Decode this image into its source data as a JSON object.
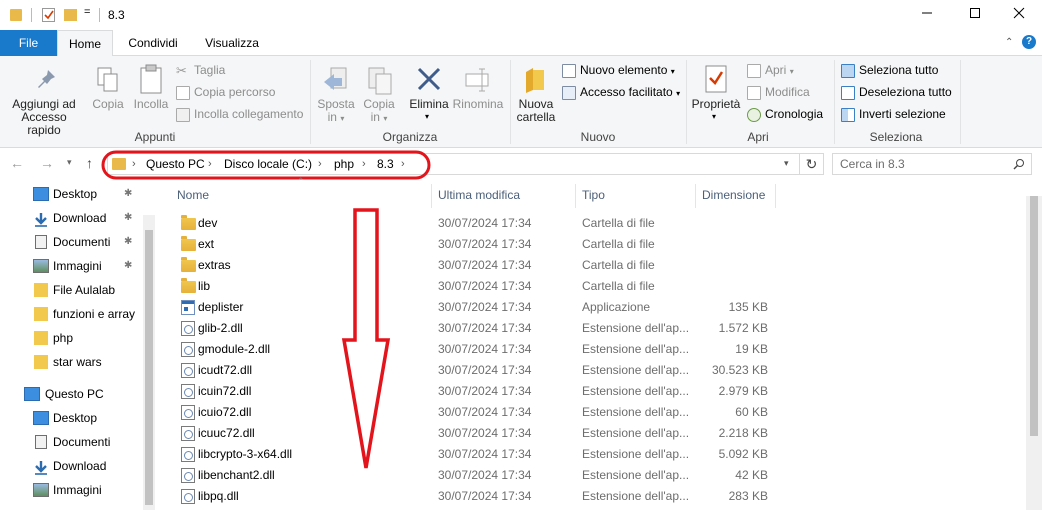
{
  "window": {
    "title": "8.3",
    "qa_dropdown": "="
  },
  "ribbon_tabs": [
    {
      "label": "File"
    },
    {
      "label": "Home"
    },
    {
      "label": "Condividi"
    },
    {
      "label": "Visualizza"
    }
  ],
  "ribbon": {
    "appunti": {
      "group_label": "Appunti",
      "pin_label_1": "Aggiungi ad",
      "pin_label_2": "Accesso rapido",
      "copy": "Copia",
      "paste": "Incolla",
      "cut": "Taglia",
      "copy_path": "Copia percorso",
      "paste_shortcut": "Incolla collegamento"
    },
    "organizza": {
      "group_label": "Organizza",
      "move_1": "Sposta",
      "move_2": "in",
      "copyto_1": "Copia",
      "copyto_2": "in",
      "delete": "Elimina",
      "rename": "Rinomina"
    },
    "nuovo": {
      "group_label": "Nuovo",
      "new_folder_1": "Nuova",
      "new_folder_2": "cartella",
      "new_item": "Nuovo elemento",
      "easy_access": "Accesso facilitato"
    },
    "apri": {
      "group_label": "Apri",
      "properties": "Proprietà",
      "open": "Apri",
      "edit": "Modifica",
      "history": "Cronologia"
    },
    "seleziona": {
      "group_label": "Seleziona",
      "select_all": "Seleziona tutto",
      "select_none": "Deseleziona tutto",
      "invert": "Inverti selezione"
    }
  },
  "address": {
    "crumbs": [
      "Questo PC",
      "Disco locale (C:)",
      "php",
      "8.3"
    ],
    "search_placeholder": "Cerca in 8.3"
  },
  "nav": {
    "quick_access": [
      {
        "label": "Desktop",
        "pinned": true
      },
      {
        "label": "Download",
        "pinned": true
      },
      {
        "label": "Documenti",
        "pinned": true
      },
      {
        "label": "Immagini",
        "pinned": true
      },
      {
        "label": "File Aulalab",
        "pinned": false
      },
      {
        "label": "funzioni e array",
        "pinned": false
      },
      {
        "label": "php",
        "pinned": false
      },
      {
        "label": "star wars",
        "pinned": false
      }
    ],
    "this_pc": "Questo PC",
    "this_pc_items": [
      {
        "label": "Desktop"
      },
      {
        "label": "Documenti"
      },
      {
        "label": "Download"
      },
      {
        "label": "Immagini"
      }
    ],
    "pin_glyph": "✱"
  },
  "columns": {
    "name": "Nome",
    "date": "Ultima modifica",
    "type": "Tipo",
    "size": "Dimensione"
  },
  "files": [
    {
      "name": "dev",
      "date": "30/07/2024 17:34",
      "type": "Cartella di file",
      "size": "",
      "icon": "folder-icon"
    },
    {
      "name": "ext",
      "date": "30/07/2024 17:34",
      "type": "Cartella di file",
      "size": "",
      "icon": "folder-icon"
    },
    {
      "name": "extras",
      "date": "30/07/2024 17:34",
      "type": "Cartella di file",
      "size": "",
      "icon": "folder-icon"
    },
    {
      "name": "lib",
      "date": "30/07/2024 17:34",
      "type": "Cartella di file",
      "size": "",
      "icon": "folder-icon"
    },
    {
      "name": "deplister",
      "date": "30/07/2024 17:34",
      "type": "Applicazione",
      "size": "135 KB",
      "icon": "application-icon"
    },
    {
      "name": "glib-2.dll",
      "date": "30/07/2024 17:34",
      "type": "Estensione dell'ap...",
      "size": "1.572 KB",
      "icon": "dll-icon"
    },
    {
      "name": "gmodule-2.dll",
      "date": "30/07/2024 17:34",
      "type": "Estensione dell'ap...",
      "size": "19 KB",
      "icon": "dll-icon"
    },
    {
      "name": "icudt72.dll",
      "date": "30/07/2024 17:34",
      "type": "Estensione dell'ap...",
      "size": "30.523 KB",
      "icon": "dll-icon"
    },
    {
      "name": "icuin72.dll",
      "date": "30/07/2024 17:34",
      "type": "Estensione dell'ap...",
      "size": "2.979 KB",
      "icon": "dll-icon"
    },
    {
      "name": "icuio72.dll",
      "date": "30/07/2024 17:34",
      "type": "Estensione dell'ap...",
      "size": "60 KB",
      "icon": "dll-icon"
    },
    {
      "name": "icuuc72.dll",
      "date": "30/07/2024 17:34",
      "type": "Estensione dell'ap...",
      "size": "2.218 KB",
      "icon": "dll-icon"
    },
    {
      "name": "libcrypto-3-x64.dll",
      "date": "30/07/2024 17:34",
      "type": "Estensione dell'ap...",
      "size": "5.092 KB",
      "icon": "dll-icon"
    },
    {
      "name": "libenchant2.dll",
      "date": "30/07/2024 17:34",
      "type": "Estensione dell'ap...",
      "size": "42 KB",
      "icon": "dll-icon"
    },
    {
      "name": "libpq.dll",
      "date": "30/07/2024 17:34",
      "type": "Estensione dell'ap...",
      "size": "283 KB",
      "icon": "dll-icon"
    }
  ],
  "colors": {
    "accent": "#1979ca",
    "annotation": "#e3141b",
    "folder": "#e9b949"
  }
}
